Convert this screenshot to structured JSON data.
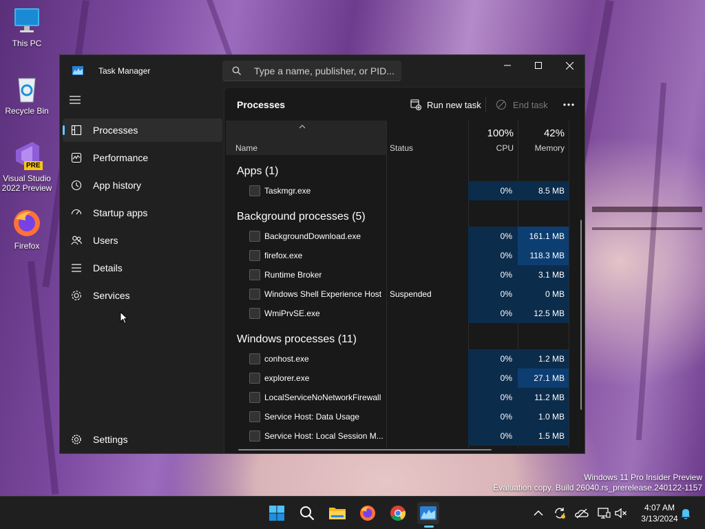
{
  "desktop": {
    "icons": [
      {
        "label": "This PC",
        "icon": "monitor-icon"
      },
      {
        "label": "Recycle Bin",
        "icon": "recycle-bin-icon"
      },
      {
        "label": "Visual Studio 2022 Preview",
        "icon": "visual-studio-icon",
        "badge": "PRE"
      },
      {
        "label": "Firefox",
        "icon": "firefox-icon"
      }
    ]
  },
  "window": {
    "title": "Task Manager",
    "search_placeholder": "Type a name, publisher, or PID...",
    "controls": [
      "minimize",
      "maximize",
      "close"
    ]
  },
  "nav": {
    "items": [
      {
        "label": "Processes",
        "icon": "processes-icon",
        "active": true
      },
      {
        "label": "Performance",
        "icon": "performance-icon"
      },
      {
        "label": "App history",
        "icon": "app-history-icon"
      },
      {
        "label": "Startup apps",
        "icon": "startup-apps-icon"
      },
      {
        "label": "Users",
        "icon": "users-icon"
      },
      {
        "label": "Details",
        "icon": "details-icon"
      },
      {
        "label": "Services",
        "icon": "services-icon"
      }
    ],
    "settings_label": "Settings"
  },
  "toolbar": {
    "heading": "Processes",
    "run_new_task": "Run new task",
    "end_task": "End task"
  },
  "columns": {
    "name": "Name",
    "status": "Status",
    "cpu_pct": "100%",
    "cpu": "CPU",
    "memory_pct": "42%",
    "memory": "Memory"
  },
  "groups": [
    {
      "title": "Apps (1)",
      "rows": [
        {
          "name": "Taskmgr.exe",
          "status": "",
          "cpu": "0%",
          "memory": "8.5 MB"
        }
      ]
    },
    {
      "title": "Background processes (5)",
      "rows": [
        {
          "name": "BackgroundDownload.exe",
          "status": "",
          "cpu": "0%",
          "memory": "161.1 MB",
          "hi": true
        },
        {
          "name": "firefox.exe",
          "status": "",
          "cpu": "0%",
          "memory": "118.3 MB",
          "hi": true
        },
        {
          "name": "Runtime Broker",
          "status": "",
          "cpu": "0%",
          "memory": "3.1 MB"
        },
        {
          "name": "Windows Shell Experience Host",
          "status": "Suspended",
          "cpu": "0%",
          "memory": "0 MB"
        },
        {
          "name": "WmiPrvSE.exe",
          "status": "",
          "cpu": "0%",
          "memory": "12.5 MB"
        }
      ]
    },
    {
      "title": "Windows processes (11)",
      "rows": [
        {
          "name": "conhost.exe",
          "status": "",
          "cpu": "0%",
          "memory": "1.2 MB"
        },
        {
          "name": "explorer.exe",
          "status": "",
          "cpu": "0%",
          "memory": "27.1 MB",
          "hi": true
        },
        {
          "name": "LocalServiceNoNetworkFirewall",
          "status": "",
          "cpu": "0%",
          "memory": "11.2 MB"
        },
        {
          "name": "Service Host: Data Usage",
          "status": "",
          "cpu": "0%",
          "memory": "1.0 MB"
        },
        {
          "name": "Service Host: Local Session M...",
          "status": "",
          "cpu": "0%",
          "memory": "1.5 MB"
        }
      ]
    }
  ],
  "watermark": {
    "line1": "Windows 11 Pro Insider Preview",
    "line2": "Evaluation copy. Build 26040.rs_prerelease.240122-1157"
  },
  "taskbar": {
    "pinned": [
      "start-icon",
      "search-icon",
      "file-explorer-icon",
      "firefox-icon",
      "chrome-icon",
      "task-manager-icon"
    ],
    "active": "task-manager-icon",
    "tray": [
      "chevron-up-icon",
      "sync-icon",
      "onedrive-icon",
      "network-icon",
      "volume-muted-icon",
      "notification-bell-icon"
    ],
    "time": "4:07 AM",
    "date": "3/13/2024"
  },
  "colors": {
    "accent": "#60cdff",
    "window_bg": "#202020",
    "content_bg": "#191919",
    "heat_low": "#0c2c4c",
    "heat_high": "#0d3e72"
  }
}
